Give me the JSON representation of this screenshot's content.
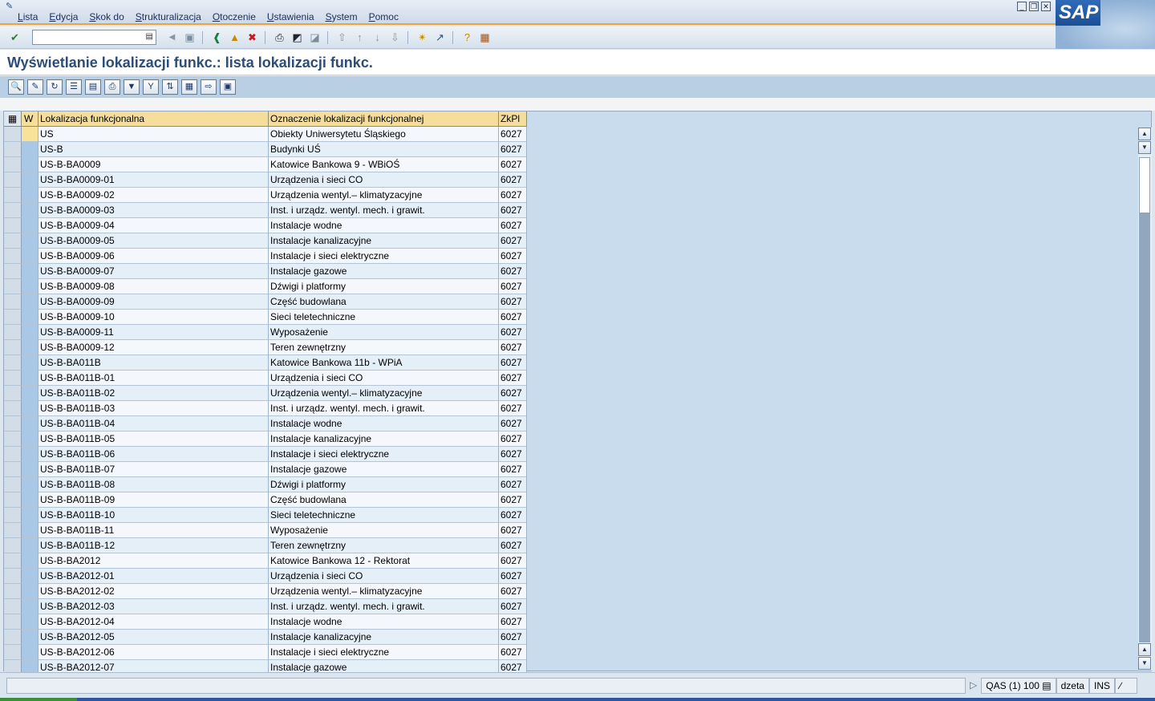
{
  "menu": {
    "items": [
      "Lista",
      "Edycja",
      "Skok do",
      "Strukturalizacja",
      "Otoczenie",
      "Ustawienia",
      "System",
      "Pomoc"
    ]
  },
  "window_controls": [
    "_",
    "❐",
    "✕"
  ],
  "logo": {
    "text": "SAP"
  },
  "command_field": {
    "value": ""
  },
  "title": "Wyświetlanie lokalizacji funkc.: lista lokalizacji funkc.",
  "grid": {
    "headers": {
      "w": "W",
      "location": "Lokalizacja funkcjonalna",
      "description": "Oznaczenie lokalizacji funkcjonalnej",
      "zkpl": "ZkPl"
    },
    "rows": [
      [
        "US",
        "Obiekty Uniwersytetu Śląskiego",
        "6027"
      ],
      [
        "US-B",
        "Budynki UŚ",
        "6027"
      ],
      [
        "US-B-BA0009",
        "Katowice Bankowa 9 - WBiOŚ",
        "6027"
      ],
      [
        "US-B-BA0009-01",
        "Urządzenia i sieci CO",
        "6027"
      ],
      [
        "US-B-BA0009-02",
        "Urządzenia wentyl.– klimatyzacyjne",
        "6027"
      ],
      [
        "US-B-BA0009-03",
        "Inst. i urządz. wentyl. mech. i grawit.",
        "6027"
      ],
      [
        "US-B-BA0009-04",
        "Instalacje wodne",
        "6027"
      ],
      [
        "US-B-BA0009-05",
        "Instalacje kanalizacyjne",
        "6027"
      ],
      [
        "US-B-BA0009-06",
        "Instalacje i sieci elektryczne",
        "6027"
      ],
      [
        "US-B-BA0009-07",
        "Instalacje gazowe",
        "6027"
      ],
      [
        "US-B-BA0009-08",
        "Dźwigi i platformy",
        "6027"
      ],
      [
        "US-B-BA0009-09",
        "Część budowlana",
        "6027"
      ],
      [
        "US-B-BA0009-10",
        "Sieci teletechniczne",
        "6027"
      ],
      [
        "US-B-BA0009-11",
        "Wyposażenie",
        "6027"
      ],
      [
        "US-B-BA0009-12",
        "Teren zewnętrzny",
        "6027"
      ],
      [
        "US-B-BA011B",
        "Katowice Bankowa 11b - WPiA",
        "6027"
      ],
      [
        "US-B-BA011B-01",
        "Urządzenia i sieci CO",
        "6027"
      ],
      [
        "US-B-BA011B-02",
        "Urządzenia wentyl.– klimatyzacyjne",
        "6027"
      ],
      [
        "US-B-BA011B-03",
        "Inst. i urządz. wentyl. mech. i grawit.",
        "6027"
      ],
      [
        "US-B-BA011B-04",
        "Instalacje wodne",
        "6027"
      ],
      [
        "US-B-BA011B-05",
        "Instalacje kanalizacyjne",
        "6027"
      ],
      [
        "US-B-BA011B-06",
        "Instalacje i sieci elektryczne",
        "6027"
      ],
      [
        "US-B-BA011B-07",
        "Instalacje gazowe",
        "6027"
      ],
      [
        "US-B-BA011B-08",
        "Dźwigi i platformy",
        "6027"
      ],
      [
        "US-B-BA011B-09",
        "Część budowlana",
        "6027"
      ],
      [
        "US-B-BA011B-10",
        "Sieci teletechniczne",
        "6027"
      ],
      [
        "US-B-BA011B-11",
        "Wyposażenie",
        "6027"
      ],
      [
        "US-B-BA011B-12",
        "Teren zewnętrzny",
        "6027"
      ],
      [
        "US-B-BA2012",
        "Katowice Bankowa 12 - Rektorat",
        "6027"
      ],
      [
        "US-B-BA2012-01",
        "Urządzenia i sieci CO",
        "6027"
      ],
      [
        "US-B-BA2012-02",
        "Urządzenia wentyl.– klimatyzacyjne",
        "6027"
      ],
      [
        "US-B-BA2012-03",
        "Inst. i urządz. wentyl. mech. i grawit.",
        "6027"
      ],
      [
        "US-B-BA2012-04",
        "Instalacje wodne",
        "6027"
      ],
      [
        "US-B-BA2012-05",
        "Instalacje kanalizacyjne",
        "6027"
      ],
      [
        "US-B-BA2012-06",
        "Instalacje i sieci elektryczne",
        "6027"
      ],
      [
        "US-B-BA2012-07",
        "Instalacje gazowe",
        "6027"
      ]
    ]
  },
  "status": {
    "system": "QAS (1) 100",
    "user": "dzeta",
    "mode": "INS"
  }
}
